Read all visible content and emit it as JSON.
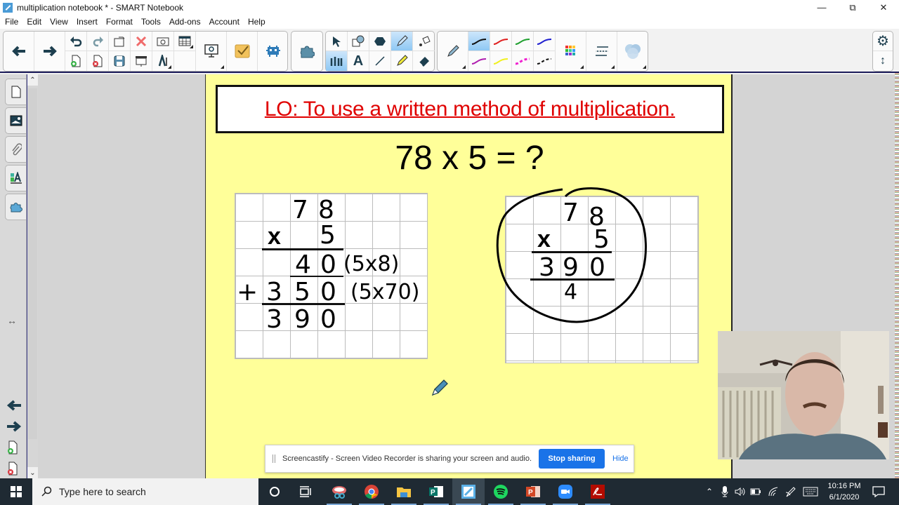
{
  "window": {
    "title": "multiplication notebook * - SMART Notebook",
    "app_icon": "smart-notebook-icon",
    "controls": [
      "minimize-icon",
      "restore-icon",
      "close-icon"
    ]
  },
  "menu": [
    "File",
    "Edit",
    "View",
    "Insert",
    "Format",
    "Tools",
    "Add-ons",
    "Account",
    "Help"
  ],
  "toolbar": {
    "navigation": [
      "back-arrow-icon",
      "forward-arrow-icon"
    ],
    "edit_top": [
      "undo-icon",
      "redo-icon",
      "page-rotate-icon",
      "delete-icon",
      "screen-capture-icon",
      "table-icon"
    ],
    "edit_bottom": [
      "add-page-icon",
      "delete-page-icon",
      "save-icon",
      "screen-shade-icon",
      "measurement-tools-icon"
    ],
    "extras": [
      "document-camera-icon",
      "response-icon",
      "lab-activity-icon",
      "addons-icon"
    ],
    "tools_top": [
      "select-icon",
      "shapes-icon",
      "regular-polygon-icon",
      "pen-icon",
      "fill-icon"
    ],
    "tools_bottom": [
      "pens-multi-icon",
      "text-icon",
      "line-icon",
      "highlighter-icon",
      "eraser-icon"
    ],
    "selected_tool": "pen-icon",
    "pen_colors": [
      {
        "name": "black",
        "color": "#111111"
      },
      {
        "name": "red",
        "color": "#e02020"
      },
      {
        "name": "green",
        "color": "#20a030"
      },
      {
        "name": "blue",
        "color": "#2020d0"
      },
      {
        "name": "purple",
        "color": "#b020b0"
      },
      {
        "name": "yellow",
        "color": "#f0f020"
      },
      {
        "name": "magenta-dashed",
        "color": "#f020d0"
      },
      {
        "name": "black-dashed",
        "color": "#111111"
      }
    ],
    "selected_color": "black",
    "right": [
      "settings-gear-icon",
      "move-toolbar-icon"
    ]
  },
  "sidebar": {
    "tabs": [
      "page-sorter-icon",
      "gallery-icon",
      "attachments-icon",
      "properties-icon",
      "addons-icon"
    ],
    "bottom": [
      "resize-horizontal-icon",
      "previous-page-icon",
      "next-page-icon",
      "add-page-icon",
      "delete-page-icon"
    ]
  },
  "page": {
    "learning_objective": "LO: To use a written method of multiplication.",
    "equation": "78 x 5 = ?",
    "left_working": {
      "rows": [
        {
          "cells": [
            "",
            "",
            "7",
            "8"
          ]
        },
        {
          "cells": [
            "",
            "x",
            "",
            "5"
          ]
        },
        {
          "cells": [
            "",
            "",
            "4",
            "0"
          ],
          "note": "(5x8)"
        },
        {
          "cells": [
            "+",
            "3",
            "5",
            "0"
          ],
          "note": "(5x70)"
        },
        {
          "cells": [
            "",
            "3",
            "9",
            "0"
          ]
        }
      ]
    },
    "right_working": {
      "rows": [
        {
          "cells": [
            "",
            "7",
            "8"
          ]
        },
        {
          "cells": [
            "x",
            "",
            "5"
          ]
        },
        {
          "cells": [
            "3",
            "9",
            "0"
          ]
        },
        {
          "cells": [
            "",
            "4",
            ""
          ]
        }
      ],
      "circled": true
    },
    "background_color": "#ffff99",
    "lo_color": "#e00000"
  },
  "share_bar": {
    "message": "Screencastify - Screen Video Recorder is sharing your screen and audio.",
    "stop_label": "Stop sharing",
    "hide_label": "Hide"
  },
  "taskbar": {
    "search_placeholder": "Type here to search",
    "apps": [
      "cortana-icon",
      "task-view-icon",
      "snipping-tool-icon",
      "chrome-icon",
      "file-explorer-icon",
      "publisher-icon",
      "smart-notebook-icon",
      "spotify-icon",
      "powerpoint-icon",
      "zoom-icon",
      "acrobat-icon"
    ],
    "active_app": "smart-notebook-icon",
    "tray": [
      "show-hidden-icon",
      "microphone-icon",
      "volume-icon",
      "battery-icon",
      "wifi-icon",
      "pen-icon",
      "keyboard-icon"
    ],
    "time": "10:16 PM",
    "date": "6/1/2020"
  }
}
